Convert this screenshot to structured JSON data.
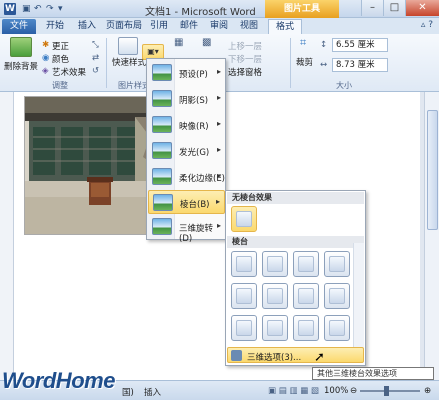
{
  "titlebar": {
    "app_icon": "W",
    "title": "文档1 - Microsoft Word",
    "context_tab_title": "图片工具",
    "minimize": "–",
    "maximize": "□",
    "close": "✕"
  },
  "tabs": [
    "文件",
    "开始",
    "插入",
    "页面布局",
    "引用",
    "邮件",
    "审阅",
    "视图",
    "格式"
  ],
  "ribbon": {
    "remove_background": "删除背景",
    "adjust_items": [
      "更正",
      "颜色",
      "艺术效果"
    ],
    "adjust_group": "调整",
    "quick_styles": "快速样式",
    "picture_styles_group": "图片样式",
    "arrange_items": [
      "上移一层",
      "下移一层",
      "选择窗格"
    ],
    "crop": "裁剪",
    "height_value": "6.55 厘米",
    "width_value": "8.73 厘米",
    "size_group": "大小"
  },
  "effects_menu": {
    "items": [
      {
        "label": "预设(P)",
        "icon": "preset-effect-icon"
      },
      {
        "label": "阴影(S)",
        "icon": "shadow-effect-icon"
      },
      {
        "label": "映像(R)",
        "icon": "reflection-effect-icon"
      },
      {
        "label": "发光(G)",
        "icon": "glow-effect-icon"
      },
      {
        "label": "柔化边缘(E)",
        "icon": "soft-edges-effect-icon"
      },
      {
        "label": "棱台(B)",
        "icon": "bevel-effect-icon"
      },
      {
        "label": "三维旋转(D)",
        "icon": "3d-rotation-effect-icon"
      }
    ],
    "highlighted_index": 5
  },
  "bevel_submenu": {
    "no_bevel_header": "无棱台效果",
    "bevel_header": "棱台",
    "footer_option": "三维选项(3)..."
  },
  "tooltip": "其他三维棱台效果选项",
  "statusbar": {
    "watermark": "WordHome",
    "mode_partial": "国)",
    "insert_mode": "插入",
    "zoom": "100%"
  }
}
